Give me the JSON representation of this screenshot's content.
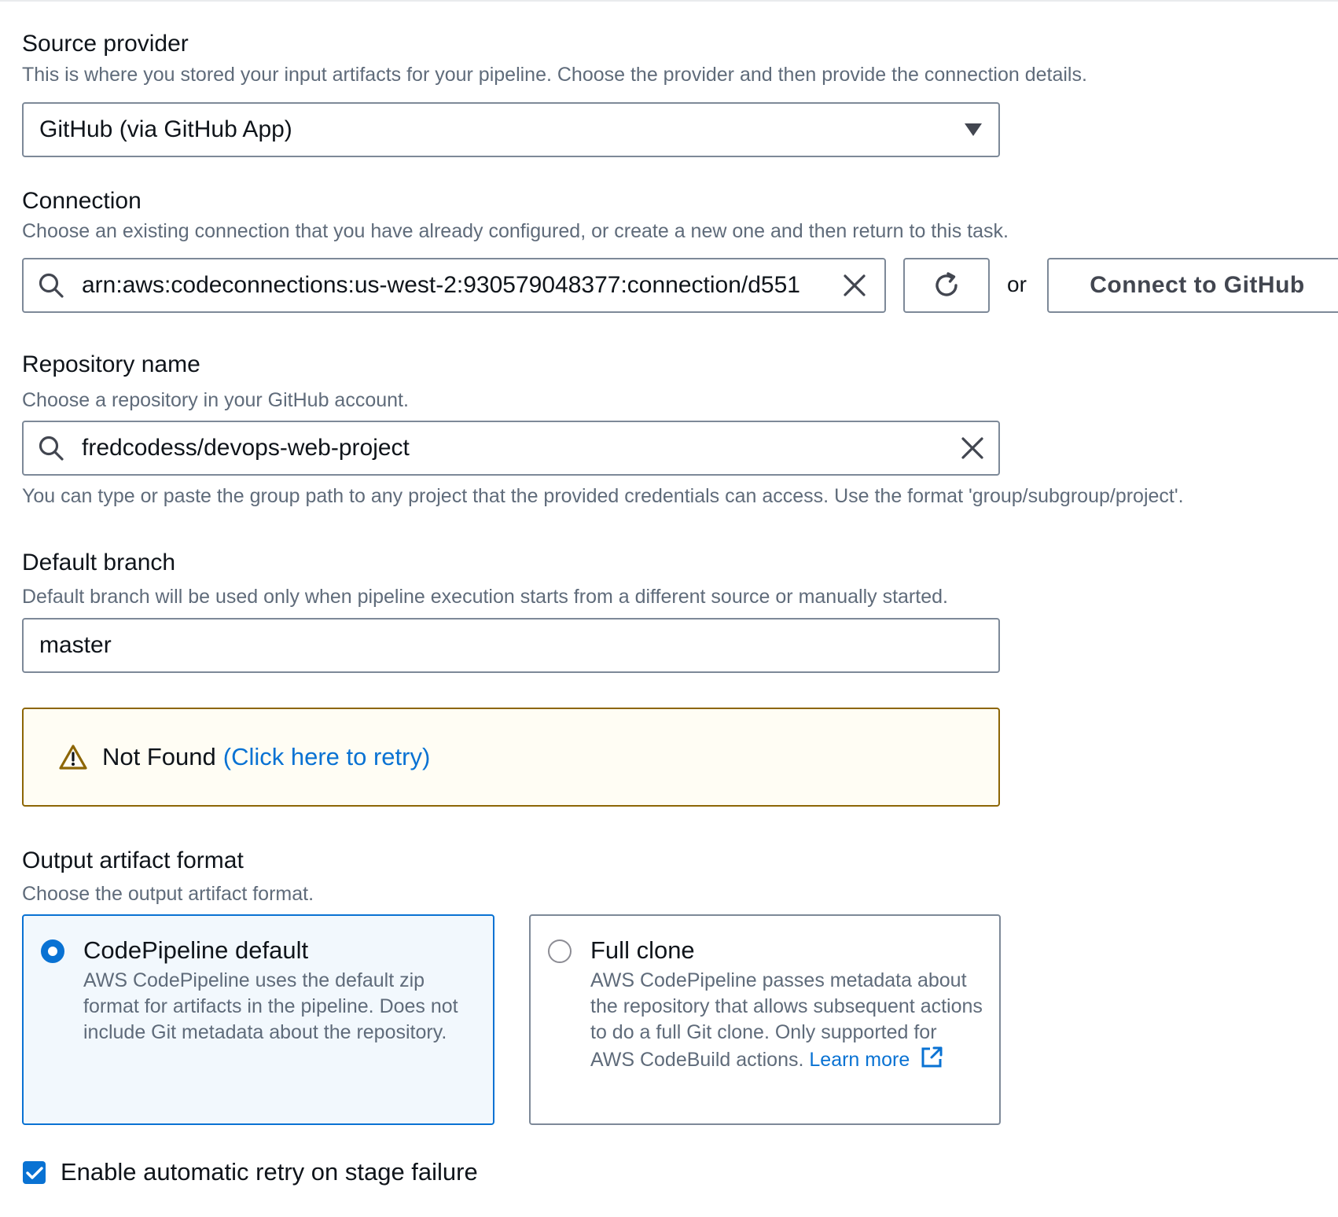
{
  "source_provider": {
    "label": "Source provider",
    "description": "This is where you stored your input artifacts for your pipeline. Choose the provider and then provide the connection details.",
    "selected": "GitHub (via GitHub App)",
    "dropdown_icon": "caret-down-icon"
  },
  "connection": {
    "label": "Connection",
    "description": "Choose an existing connection that you have already configured, or create a new one and then return to this task.",
    "value": "arn:aws:codeconnections:us-west-2:930579048377:connection/d551",
    "or_text": "or",
    "connect_button": "Connect to GitHub",
    "icons": [
      "search-icon",
      "clear-icon",
      "refresh-icon"
    ]
  },
  "repository": {
    "label": "Repository name",
    "description": "Choose a repository in your GitHub account.",
    "value": "fredcodess/devops-web-project",
    "constraint": "You can type or paste the group path to any project that the provided credentials can access. Use the format 'group/subgroup/project'."
  },
  "default_branch": {
    "label": "Default branch",
    "description": "Default branch will be used only when pipeline execution starts from a different source or manually started.",
    "value": "master"
  },
  "alert": {
    "text": "Not Found",
    "link": "(Click here to retry)",
    "icon": "warning-icon",
    "border_color": "#8d6605",
    "background": "#fffdf4"
  },
  "output_format": {
    "label": "Output artifact format",
    "description": "Choose the output artifact format.",
    "options": [
      {
        "title": "CodePipeline default",
        "description": "AWS CodePipeline uses the default zip format for artifacts in the pipeline. Does not include Git metadata about the repository.",
        "selected": true
      },
      {
        "title": "Full clone",
        "description": "AWS CodePipeline passes metadata about the repository that allows subsequent actions to do a full Git clone. Only supported for AWS CodeBuild actions.",
        "link": "Learn more",
        "selected": false
      }
    ]
  },
  "retry": {
    "label": "Enable automatic retry on stage failure",
    "checked": true
  },
  "colors": {
    "accent": "#0972d3",
    "text": "#0f141a",
    "secondary_text": "#5f6b7a",
    "border": "#7d8998"
  }
}
